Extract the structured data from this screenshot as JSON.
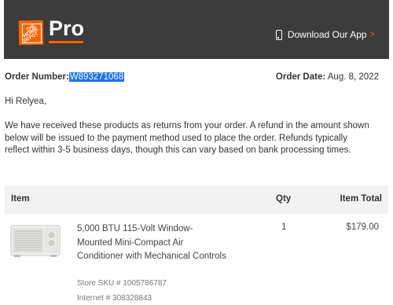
{
  "header": {
    "logo_line1": "THE",
    "logo_line2": "HOME",
    "logo_line3": "DEPOT",
    "brand_suffix": "Pro",
    "download_label": "Download Our App",
    "download_chevron": ">"
  },
  "order": {
    "number_label": "Order Number:",
    "number_value": "W893271068",
    "date_label": "Order Date:",
    "date_value": "Aug. 8, 2022"
  },
  "greeting": "Hi Relyea,",
  "message": "We have received these products as returns from your order. A refund in the amount shown below will be issued to the payment method used to place the order. Refunds typically reflect within 3-5 business days, though this can vary based on bank processing times.",
  "table": {
    "headers": {
      "item": "Item",
      "qty": "Qty",
      "total": "Item Total"
    },
    "items": [
      {
        "name": "5,000 BTU 115-Volt Window-Mounted Mini-Compact Air Conditioner with Mechanical Controls",
        "qty": "1",
        "total": "$179.00",
        "store_sku": "Store SKU # 1005786787",
        "internet": "Internet # 308328843"
      }
    ]
  },
  "colors": {
    "header_bg": "#3c3c3c",
    "brand_orange": "#f96302",
    "selection_blue": "#1a73e8"
  },
  "icons": {
    "app": "phone-icon",
    "product": "air-conditioner-image"
  }
}
